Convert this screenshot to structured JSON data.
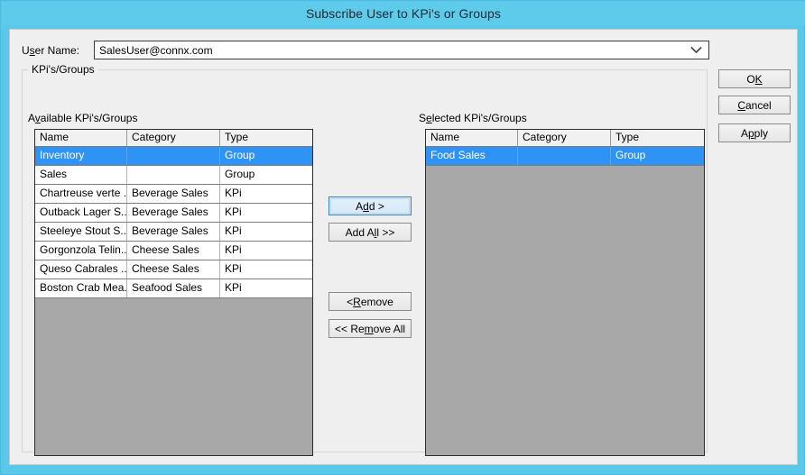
{
  "window": {
    "title": "Subscribe User to KPi's or Groups",
    "titlebar_color": "#5fcbeb",
    "client_color": "#efeff0",
    "selection_color": "#2f92f5",
    "listbox_empty_color": "#a8a8a8"
  },
  "user_name": {
    "label_pre": "U",
    "label_mn": "s",
    "label_post": "er Name:",
    "label_full": "User Name:",
    "value": "SalesUser@connx.com",
    "placeholder": "",
    "arrow_icon": "chevron-down-icon"
  },
  "groupbox": {
    "label": "KPi's/Groups"
  },
  "available": {
    "caption_pre": "A",
    "caption_mn": "v",
    "caption_post": "ailable KPi's/Groups",
    "caption_full": "Available KPi's/Groups",
    "columns": [
      "Name",
      "Category",
      "Type"
    ],
    "rows": [
      {
        "name": "Inventory",
        "category": "",
        "type": "Group",
        "selected": true
      },
      {
        "name": "Sales",
        "category": "",
        "type": "Group",
        "selected": false
      },
      {
        "name": "Chartreuse verte ...",
        "category": "Beverage Sales",
        "type": "KPi",
        "selected": false
      },
      {
        "name": "Outback Lager S...",
        "category": "Beverage Sales",
        "type": "KPi",
        "selected": false
      },
      {
        "name": "Steeleye Stout S...",
        "category": "Beverage Sales",
        "type": "KPi",
        "selected": false
      },
      {
        "name": "Gorgonzola Telin...",
        "category": "Cheese Sales",
        "type": "KPi",
        "selected": false
      },
      {
        "name": "Queso Cabrales ...",
        "category": "Cheese Sales",
        "type": "KPi",
        "selected": false
      },
      {
        "name": "Boston Crab Mea...",
        "category": "Seafood Sales",
        "type": "KPi",
        "selected": false
      }
    ]
  },
  "selected": {
    "caption_pre": "S",
    "caption_mn": "e",
    "caption_post": "lected KPi's/Groups",
    "caption_full": "Selected KPi's/Groups",
    "columns": [
      "Name",
      "Category",
      "Type"
    ],
    "rows": [
      {
        "name": "Food Sales",
        "category": "",
        "type": "Group",
        "selected": true
      }
    ]
  },
  "transfer_buttons": {
    "add": {
      "pre": "A",
      "mn": "d",
      "post": "d >",
      "full": "Add >",
      "focused": true
    },
    "add_all": {
      "pre": "Add A",
      "mn": "l",
      "post": "l >>",
      "full": "Add All >>",
      "focused": false
    },
    "remove": {
      "pre": "< ",
      "mn": "R",
      "post": "emove",
      "full": "< Remove",
      "focused": false
    },
    "remove_all": {
      "pre": "<< Re",
      "mn": "m",
      "post": "ove All",
      "full": "<< Remove All",
      "focused": false
    }
  },
  "command_buttons": {
    "ok": {
      "pre": "O",
      "mn": "K",
      "post": "",
      "full": "OK"
    },
    "cancel": {
      "pre": "",
      "mn": "C",
      "post": "ancel",
      "full": "Cancel"
    },
    "apply": {
      "pre": "A",
      "mn": "p",
      "post": "ply",
      "full": "Apply"
    }
  }
}
